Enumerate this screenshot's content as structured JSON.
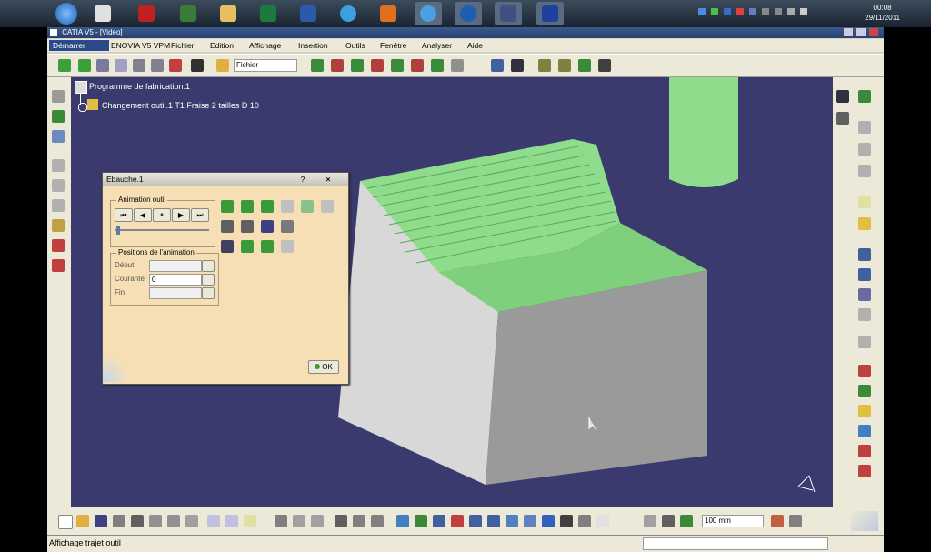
{
  "taskbar": {
    "icons": [
      "start-orb",
      "catia-launcher-icon",
      "acrobat-icon",
      "ti-nspire-icon",
      "explorer-icon",
      "excel-icon",
      "word-icon",
      "ie-icon",
      "media-icon",
      "chrome-icon",
      "ccleaner-icon",
      "photo-icon",
      "screen-icon"
    ],
    "clock_time": "00:08",
    "clock_date": "29/11/2011"
  },
  "window": {
    "title": "CATIA V5 - [Vidéo]"
  },
  "menu": {
    "items": [
      "Démarrer",
      "ENOVIA V5 VPM",
      "Fichier",
      "Edition",
      "Affichage",
      "Insertion",
      "Outils",
      "Fenêtre",
      "Analyser",
      "Aide"
    ]
  },
  "toolbar": {
    "select_value": "Fichier",
    "zoom_value": "100 mm"
  },
  "tree": {
    "root": "Programme de fabrication.1",
    "child": "Changement outil.1  T1 Fraise 2 tailles D 10"
  },
  "dialog": {
    "title": "Ebauche.1",
    "help": "?",
    "close": "×",
    "animation_group": "Animation outil",
    "positions_group": "Positions de l'animation",
    "label_debut": "Début",
    "label_courante": "Courante",
    "label_fin": "Fin",
    "courante_value": "0",
    "ok": "OK",
    "nav": [
      "⏮",
      "◀",
      "⏸",
      "▶",
      "⏭"
    ],
    "slider_fraction": 0.02
  },
  "status": {
    "text": "Affichage trajet outil"
  },
  "colors": {
    "viewport": "#3a3a6e",
    "stock_top": "#8fdc8c",
    "stock_side": "#d8d8d8",
    "dialog": "#f7dfb5"
  }
}
